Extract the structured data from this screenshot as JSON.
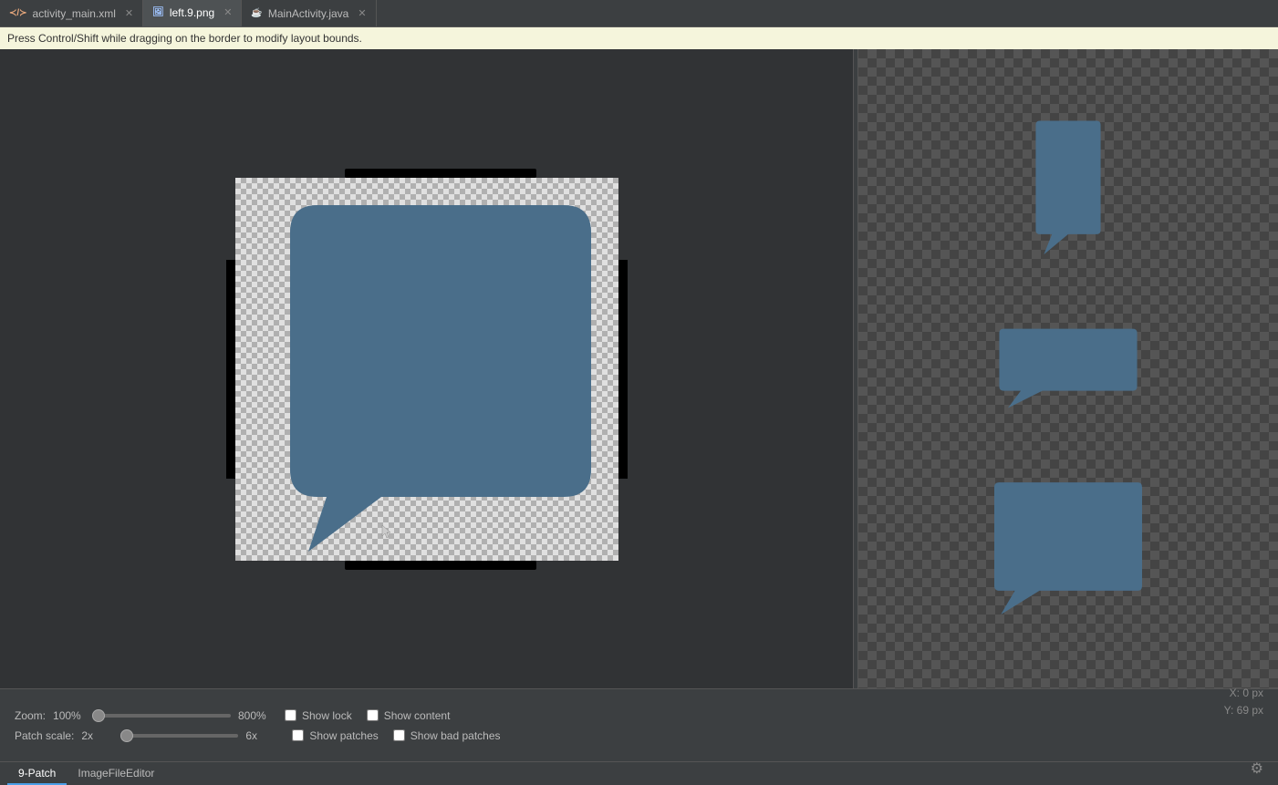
{
  "tabs": [
    {
      "id": "activity_main_xml",
      "label": "activity_main.xml",
      "type": "xml",
      "active": false
    },
    {
      "id": "left9_png",
      "label": "left.9.png",
      "type": "png",
      "active": true
    },
    {
      "id": "mainactivity_java",
      "label": "MainActivity.java",
      "type": "java",
      "active": false
    }
  ],
  "info_bar": {
    "message": "Press Control/Shift while dragging on the border to modify layout bounds."
  },
  "editor": {
    "zoom": {
      "label": "Zoom:",
      "value": "100%",
      "min": "100%",
      "max": "800%",
      "current": 0
    },
    "patch_scale": {
      "label": "Patch scale:",
      "value_left": "2x",
      "value_right": "6x",
      "current": 0
    }
  },
  "controls": {
    "show_lock": {
      "label": "Show lock",
      "checked": false
    },
    "show_patches": {
      "label": "Show patches",
      "checked": false
    },
    "show_content": {
      "label": "Show content",
      "checked": false
    },
    "show_bad_patches": {
      "label": "Show bad patches",
      "checked": false
    }
  },
  "coords": {
    "x_label": "X:",
    "x_value": "0 px",
    "y_label": "Y:",
    "y_value": "69 px"
  },
  "bottom_tabs": [
    {
      "id": "nine_patch",
      "label": "9-Patch",
      "active": true
    },
    {
      "id": "image_file_editor",
      "label": "ImageFileEditor",
      "active": false
    }
  ],
  "settings_icon": "⚙",
  "bubble_color": "#4a6e8a"
}
